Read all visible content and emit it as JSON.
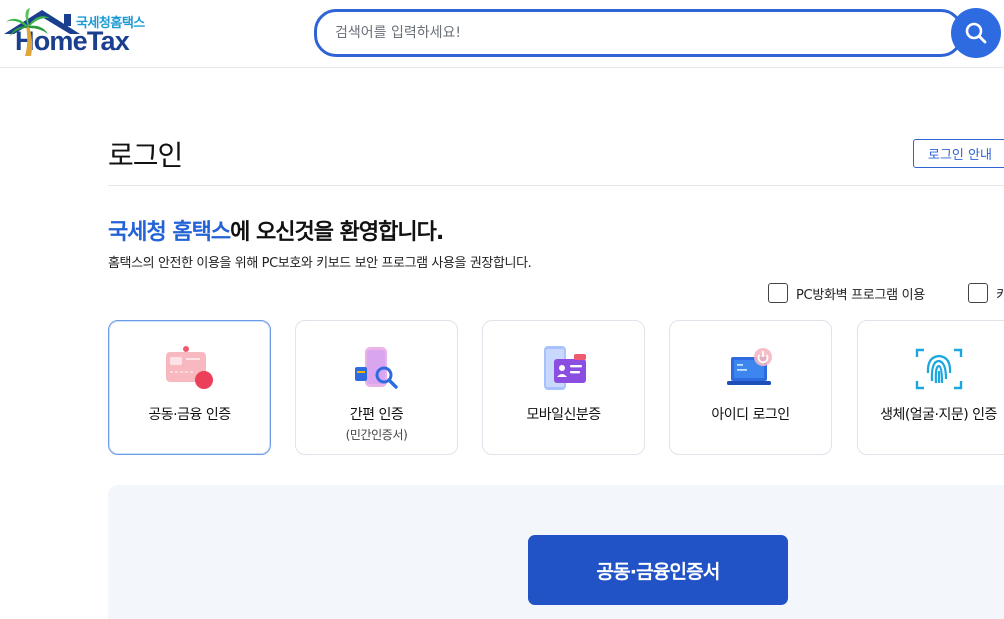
{
  "header": {
    "logo_sub": "국세청홈택스",
    "logo_main": "HomeTax",
    "search": {
      "placeholder": "검색어를 입력하세요!",
      "value": ""
    },
    "search_icon": "search-icon"
  },
  "page": {
    "title": "로그인",
    "guide_button": "로그인 안내"
  },
  "welcome": {
    "accent": "국세청 홈택스",
    "rest": "에 오신것을 환영합니다.",
    "notice": "홈택스의 안전한 이용을 위해 PC보호와 키보드 보안 프로그램 사용을 권장합니다."
  },
  "options": [
    {
      "label": "PC방화벽 프로그램 이용",
      "checked": false
    },
    {
      "label": "키",
      "checked": false
    }
  ],
  "login_methods": [
    {
      "title": "공동·금융 인증",
      "sub": "",
      "icon": "certificate-card-icon",
      "active": true
    },
    {
      "title": "간편 인증",
      "sub": "(민간인증서)",
      "icon": "simple-auth-search-icon",
      "active": false
    },
    {
      "title": "모바일신분증",
      "sub": "",
      "icon": "mobile-id-icon",
      "active": false
    },
    {
      "title": "아이디 로그인",
      "sub": "",
      "icon": "laptop-power-icon",
      "active": false
    },
    {
      "title": "생체(얼굴·지문) 인증",
      "sub": "",
      "icon": "fingerprint-icon",
      "active": false
    }
  ],
  "panel": {
    "primary_button": "공동·금융인증서"
  },
  "colors": {
    "brand_blue": "#2153c6",
    "accent_blue": "#2363d6",
    "logo_navy": "#1b3f8f",
    "logo_teal": "#1d9bd3",
    "panel_bg": "#f3f6fb"
  }
}
